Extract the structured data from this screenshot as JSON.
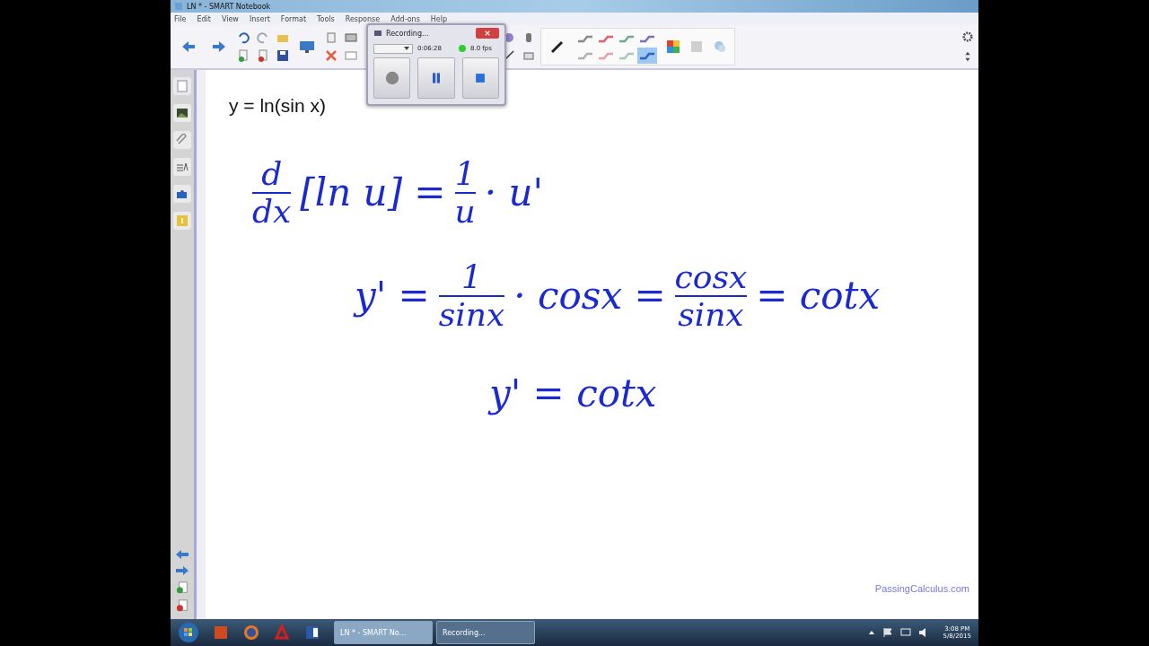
{
  "window": {
    "title": "LN * - SMART Notebook"
  },
  "menu": [
    "File",
    "Edit",
    "View",
    "Insert",
    "Format",
    "Tools",
    "Response",
    "Add-ons",
    "Help"
  ],
  "pen_styles": [
    {
      "color": "#8a8a8a",
      "selected": false
    },
    {
      "color": "#e06070",
      "selected": false
    },
    {
      "color": "#70a890",
      "selected": false
    },
    {
      "color": "#7a70c0",
      "selected": false
    },
    {
      "color": "#b0b0b0",
      "selected": false
    },
    {
      "color": "#eaa0a8",
      "selected": false
    },
    {
      "color": "#a8c8b8",
      "selected": false
    },
    {
      "color": "#3060c0",
      "selected": true
    }
  ],
  "recorder": {
    "title": "Recording...",
    "elapsed": "0:06:28",
    "rate": "8.0 fps"
  },
  "page": {
    "typed": "y = ln(sin x)",
    "handwriting": [
      [
        {
          "kind": "frac",
          "num": "d",
          "den": "dx"
        },
        {
          "kind": "text",
          "text": "[ln u] ="
        },
        {
          "kind": "frac",
          "num": "1",
          "den": "u"
        },
        {
          "kind": "text",
          "text": "· u'"
        }
      ],
      [
        {
          "kind": "text",
          "text": "y' ="
        },
        {
          "kind": "frac",
          "num": "1",
          "den": "sinx"
        },
        {
          "kind": "text",
          "text": "· cosx ="
        },
        {
          "kind": "frac",
          "num": "cosx",
          "den": "sinx"
        },
        {
          "kind": "text",
          "text": "= cotx"
        }
      ],
      [
        {
          "kind": "text",
          "text": "y' = cotx"
        }
      ]
    ],
    "footer": "PassingCalculus.com"
  },
  "taskbar": {
    "tasks": [
      {
        "label": "LN * - SMART No...",
        "selected": true
      },
      {
        "label": "Recording...",
        "selected": false
      }
    ],
    "time": "3:08 PM",
    "date": "5/8/2015"
  }
}
